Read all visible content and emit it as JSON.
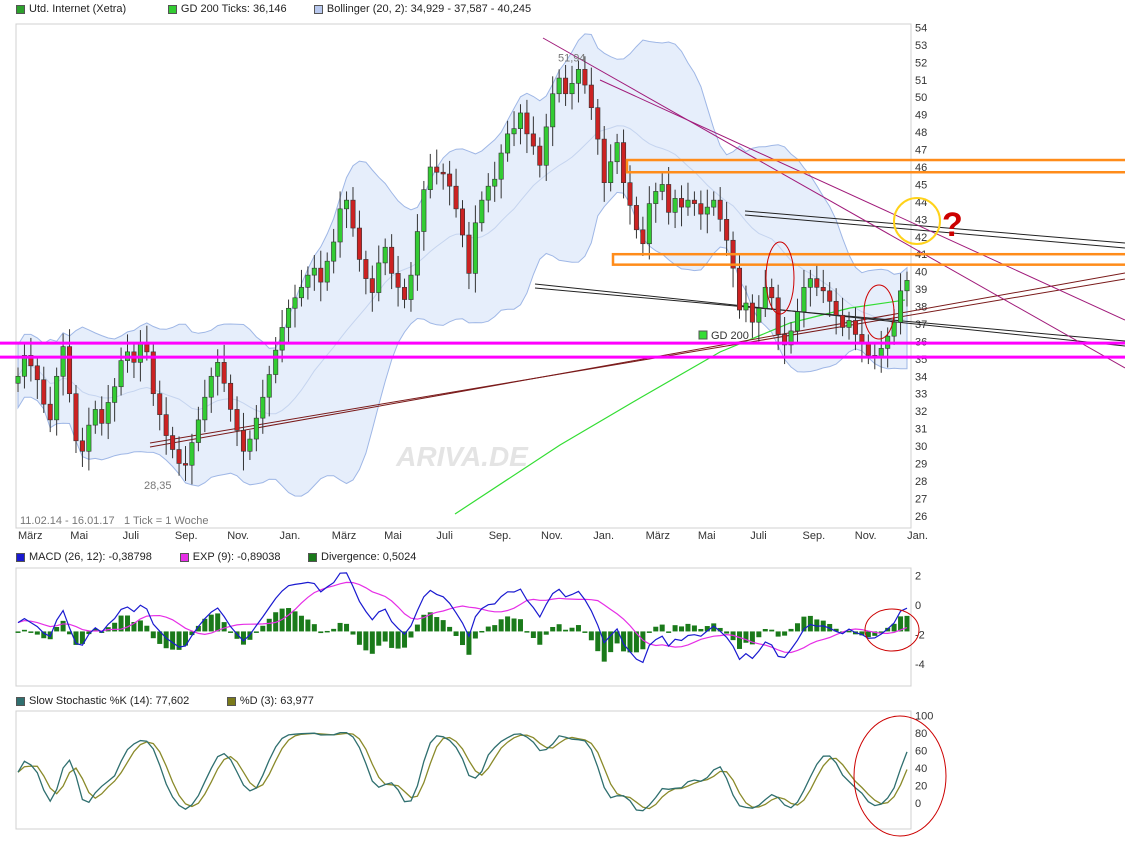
{
  "legend": {
    "main": [
      {
        "label": "Utd. Internet (Xetra)",
        "color": "#2ca02c"
      },
      {
        "label": "GD 200 Ticks: 36,146",
        "color": "#33cc33"
      },
      {
        "label": "Bollinger (20, 2): 34,929 - 37,587 - 40,245",
        "color": "#b8c8ee"
      }
    ],
    "macd": [
      {
        "label": "MACD (26, 12): -0,38798",
        "color": "#1a1ad0"
      },
      {
        "label": "EXP (9): -0,89038",
        "color": "#e62ee6"
      },
      {
        "label": "Divergence: 0,5024",
        "color": "#1a7a1a"
      }
    ],
    "stoch": [
      {
        "label": "Slow Stochastic %K (14): 77,602",
        "color": "#2f6f6f"
      },
      {
        "label": "%D (3): 63,977",
        "color": "#7a7a1a"
      }
    ]
  },
  "footer": {
    "range": "11.02.14 - 16.01.17",
    "tick": "1 Tick = 1 Woche"
  },
  "watermark": "ARIVA.DE",
  "gd_label": "GD 200",
  "question_mark": "?",
  "colors": {
    "up": "#33cc33",
    "down": "#cc2222",
    "bollinger": "#e6eefb",
    "bollinger_line": "#9fb7e6",
    "gd200": "#33dd33",
    "magenta": "#ff00ff",
    "orange": "#ff8c1a",
    "yellow": "#ffd21a",
    "annot_red": "#cc0000",
    "macd": "#1a1ad0",
    "exp": "#e62ee6",
    "div": "#1a7a1a",
    "k": "#2f6f6f",
    "d": "#8a8a2a"
  },
  "chart_data": [
    {
      "type": "candlestick",
      "title": "Utd. Internet (Xetra)",
      "x_ticks": [
        "März",
        "Mai",
        "Juli",
        "Sep.",
        "Nov.",
        "Jan.",
        "März",
        "Mai",
        "Juli",
        "Sep.",
        "Nov.",
        "Jan.",
        "März",
        "Mai",
        "Juli",
        "Sep.",
        "Nov.",
        "Jan."
      ],
      "y_ticks": [
        26,
        27,
        28,
        29,
        30,
        31,
        32,
        33,
        34,
        35,
        36,
        37,
        38,
        39,
        40,
        41,
        42,
        43,
        44,
        45,
        46,
        47,
        48,
        49,
        50,
        51,
        52,
        53,
        54
      ],
      "ylim": [
        25.3,
        54.2
      ],
      "annotations": [
        {
          "label": "51,94",
          "value": 51.94
        },
        {
          "label": "28,35",
          "value": 28.35
        }
      ],
      "close_weekly": [
        34.0,
        35.2,
        34.6,
        33.8,
        32.4,
        31.5,
        34.0,
        35.7,
        33.0,
        30.3,
        29.7,
        31.2,
        32.1,
        31.3,
        32.5,
        33.4,
        34.9,
        35.4,
        34.8,
        35.9,
        35.4,
        33.0,
        31.8,
        30.6,
        29.8,
        29.0,
        28.9,
        30.2,
        31.5,
        32.8,
        34.0,
        34.8,
        33.6,
        32.1,
        30.9,
        29.7,
        30.4,
        31.6,
        32.8,
        34.1,
        35.5,
        36.8,
        37.9,
        38.5,
        39.1,
        39.8,
        40.2,
        39.4,
        40.6,
        41.7,
        43.6,
        44.1,
        42.5,
        40.7,
        39.6,
        38.8,
        40.5,
        41.4,
        39.9,
        39.1,
        38.4,
        39.8,
        42.3,
        44.7,
        46.0,
        45.7,
        45.6,
        44.9,
        43.6,
        42.1,
        39.9,
        42.8,
        44.1,
        44.9,
        45.3,
        46.8,
        47.9,
        48.2,
        49.1,
        47.9,
        47.2,
        46.1,
        48.3,
        50.2,
        51.1,
        50.2,
        50.8,
        51.6,
        50.7,
        49.4,
        47.6,
        45.1,
        46.3,
        47.4,
        45.1,
        43.8,
        42.4,
        41.6,
        43.9,
        44.6,
        45.0,
        43.4,
        44.2,
        43.7,
        44.1,
        43.9,
        43.3,
        43.7,
        44.1,
        43.0,
        41.8,
        40.2,
        37.8,
        38.2,
        37.1,
        37.9,
        39.1,
        38.5,
        36.4,
        35.8,
        36.6,
        37.7,
        39.1,
        39.6,
        39.1,
        38.9,
        38.3,
        37.5,
        36.8,
        37.2,
        36.4,
        35.9,
        35.2,
        35.1,
        35.6,
        36.3,
        37.1,
        38.9,
        39.5
      ],
      "gd200_label": "GD 200",
      "gd200_last": 36.146,
      "bollinger": {
        "lower": 34.929,
        "mid": 37.587,
        "upper": 40.245
      },
      "horizontal_levels_magenta": [
        35.1,
        35.9
      ],
      "orange_zones": [
        [
          45.7,
          46.4
        ],
        [
          40.4,
          41.0
        ]
      ]
    },
    {
      "type": "line",
      "title": "MACD (26, 12)",
      "y_ticks": [
        "2",
        "0",
        "-2",
        "-4"
      ],
      "ylim": [
        -5.5,
        2.5
      ],
      "series": [
        {
          "name": "MACD (26, 12)",
          "last": -0.38798
        },
        {
          "name": "EXP (9)",
          "last": -0.89038
        },
        {
          "name": "Divergence",
          "last": 0.5024
        }
      ]
    },
    {
      "type": "line",
      "title": "Slow Stochastic",
      "y_ticks": [
        "100",
        "80",
        "60",
        "40",
        "20",
        "0"
      ],
      "ylim": [
        -30,
        105
      ],
      "series": [
        {
          "name": "Slow Stochastic %K (14)",
          "last": 77.602
        },
        {
          "name": "%D (3)",
          "last": 63.977
        }
      ]
    }
  ]
}
